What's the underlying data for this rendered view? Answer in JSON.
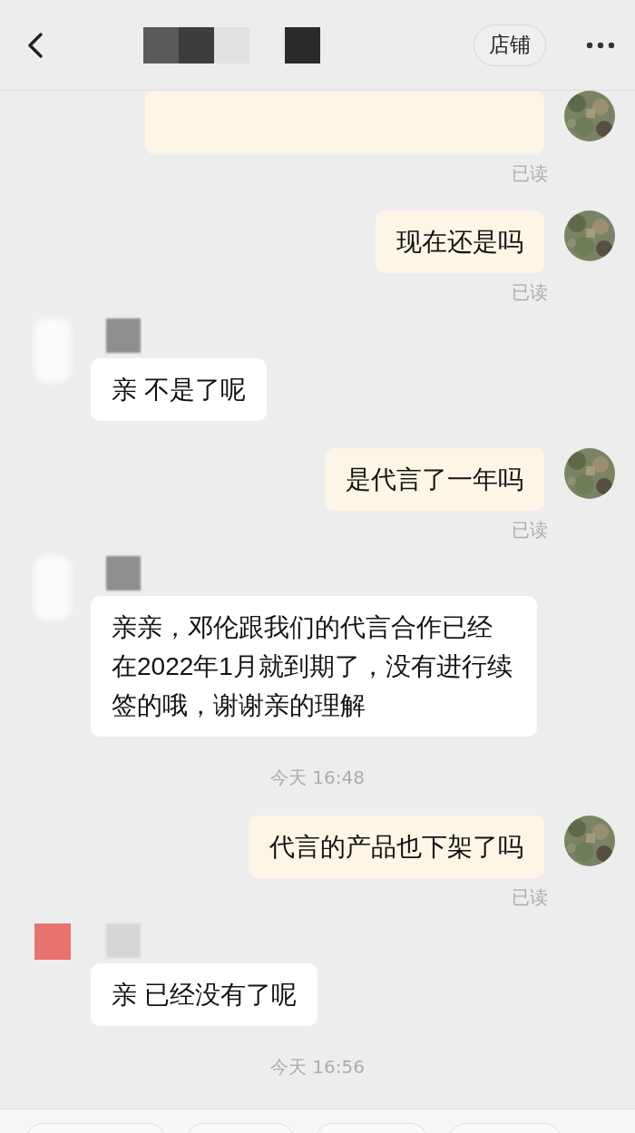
{
  "header": {
    "shop_button": "店铺"
  },
  "messages": [
    {
      "kind": "out_clipped",
      "receipt": "已读"
    },
    {
      "kind": "out",
      "text": "现在还是吗",
      "receipt": "已读"
    },
    {
      "kind": "in",
      "text": "亲 不是了呢",
      "avatar": {
        "kind": "blurred"
      }
    },
    {
      "kind": "out",
      "text": "是代言了一年吗",
      "receipt": "已读"
    },
    {
      "kind": "in",
      "text": "亲亲，邓伦跟我们的代言合作已经在2022年1月就到期了，没有进行续签的哦，谢谢亲的理解",
      "avatar": {
        "kind": "blurred"
      }
    },
    {
      "kind": "time",
      "text": "今天 16:48"
    },
    {
      "kind": "out",
      "text": "代言的产品也下架了吗",
      "receipt": "已读"
    },
    {
      "kind": "in",
      "text": "亲 已经没有了呢",
      "avatar": {
        "kind": "red"
      }
    },
    {
      "kind": "time",
      "text": "今天 16:56"
    }
  ]
}
